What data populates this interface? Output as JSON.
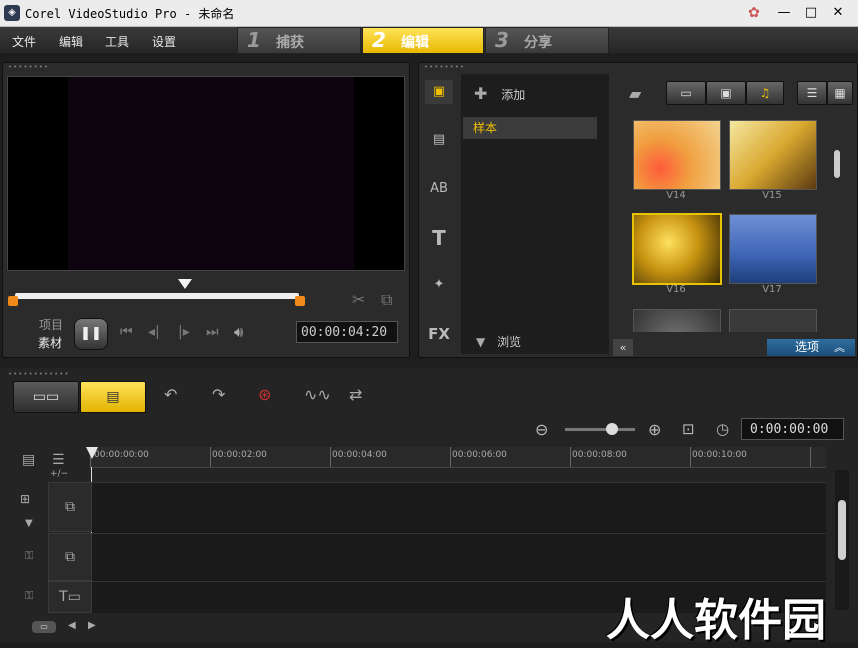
{
  "window": {
    "title": "Corel VideoStudio Pro - 未命名",
    "controls": {
      "help": "help-icon",
      "minimize": "—",
      "maximize": "□",
      "close": "✕"
    }
  },
  "menu": [
    "文件",
    "编辑",
    "工具",
    "设置"
  ],
  "steps": [
    {
      "num": "1",
      "label": "捕获",
      "active": false
    },
    {
      "num": "2",
      "label": "编辑",
      "active": true
    },
    {
      "num": "3",
      "label": "分享",
      "active": false
    }
  ],
  "player": {
    "mode_project": "项目",
    "mode_clip": "素材",
    "timecode": "00:00:04:20"
  },
  "library": {
    "add_label": "添加",
    "folder": "样本",
    "browse_label": "浏览",
    "options_label": "选项",
    "items": [
      {
        "label": "V14",
        "color": "#e07a2c",
        "selected": false
      },
      {
        "label": "V15",
        "color": "#d9b23a",
        "selected": false
      },
      {
        "label": "V16",
        "color": "#c99a1e",
        "selected": true
      },
      {
        "label": "V17",
        "color": "#5a7fc0",
        "selected": false
      },
      {
        "label": "",
        "color": "#555555",
        "selected": false
      },
      {
        "label": "",
        "color": "#444444",
        "selected": false
      }
    ]
  },
  "timeline": {
    "timecode": "0:00:00:00",
    "ruler": [
      "00:00:00:00",
      "00:00:02:00",
      "00:00:04:00",
      "00:00:06:00",
      "00:00:08:00",
      "00:00:10:00"
    ],
    "add_track_label": "+/−"
  },
  "watermark": "人人软件园"
}
